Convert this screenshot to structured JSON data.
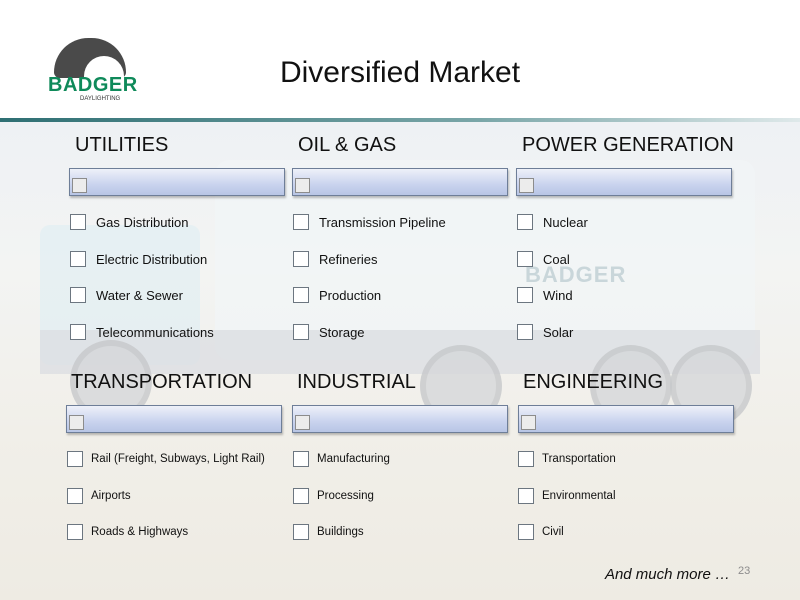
{
  "slide": {
    "title": "Diversified Market",
    "page_number": "23",
    "footer_note": "And much more …"
  },
  "logo": {
    "word": "BADGER",
    "sub": "DAYLIGHTING"
  },
  "background": {
    "truck_logo_text": "BADGER"
  },
  "colors": {
    "brand_green": "#0f8a5a",
    "bar_fill": "#c9d3ee",
    "accent_line": "#2e6f73"
  },
  "categories": [
    {
      "title": "UTILITIES",
      "items": [
        "Gas Distribution",
        "Electric Distribution",
        "Water & Sewer",
        "Telecommunications"
      ]
    },
    {
      "title": "OIL & GAS",
      "items": [
        "Transmission Pipeline",
        "Refineries",
        "Production",
        "Storage"
      ]
    },
    {
      "title": "POWER GENERATION",
      "items": [
        "Nuclear",
        "Coal",
        "Wind",
        "Solar"
      ]
    },
    {
      "title": "TRANSPORTATION",
      "items": [
        "Rail (Freight, Subways, Light Rail)",
        "Airports",
        "Roads & Highways"
      ]
    },
    {
      "title": "INDUSTRIAL",
      "items": [
        "Manufacturing",
        "Processing",
        "Buildings"
      ]
    },
    {
      "title": "ENGINEERING",
      "items": [
        "Transportation",
        "Environmental",
        "Civil"
      ]
    }
  ]
}
